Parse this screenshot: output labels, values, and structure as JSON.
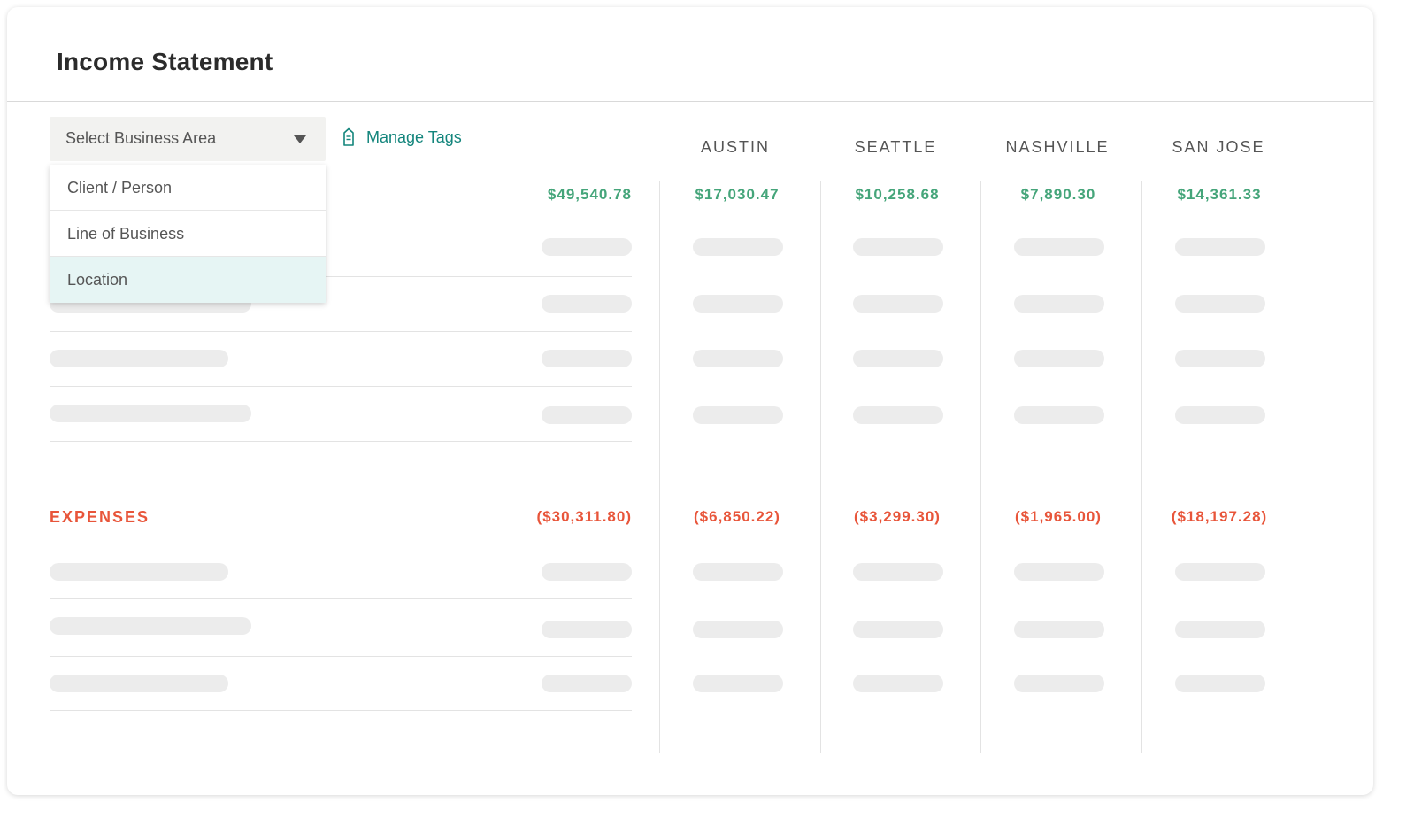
{
  "title": "Income Statement",
  "select": {
    "label": "Select Business Area"
  },
  "dropdown": {
    "options": [
      "Client / Person",
      "Line of Business",
      "Location"
    ],
    "selected": "Location"
  },
  "manage_tags": {
    "label": "Manage Tags"
  },
  "columns": [
    "AUSTIN",
    "SEATTLE",
    "NASHVILLE",
    "SAN JOSE"
  ],
  "income": {
    "total": "$49,540.78",
    "by_column": [
      "$17,030.47",
      "$10,258.68",
      "$7,890.30",
      "$14,361.33"
    ]
  },
  "expenses": {
    "label": "EXPENSES",
    "total": "($30,311.80)",
    "by_column": [
      "($6,850.22)",
      "($3,299.30)",
      "($1,965.00)",
      "($18,197.28)"
    ]
  },
  "colors": {
    "income": "#45a57a",
    "expense": "#e8553a",
    "accent": "#13857c"
  },
  "icons": {
    "manage_tags": "tag-icon",
    "select": "caret-down-icon"
  }
}
